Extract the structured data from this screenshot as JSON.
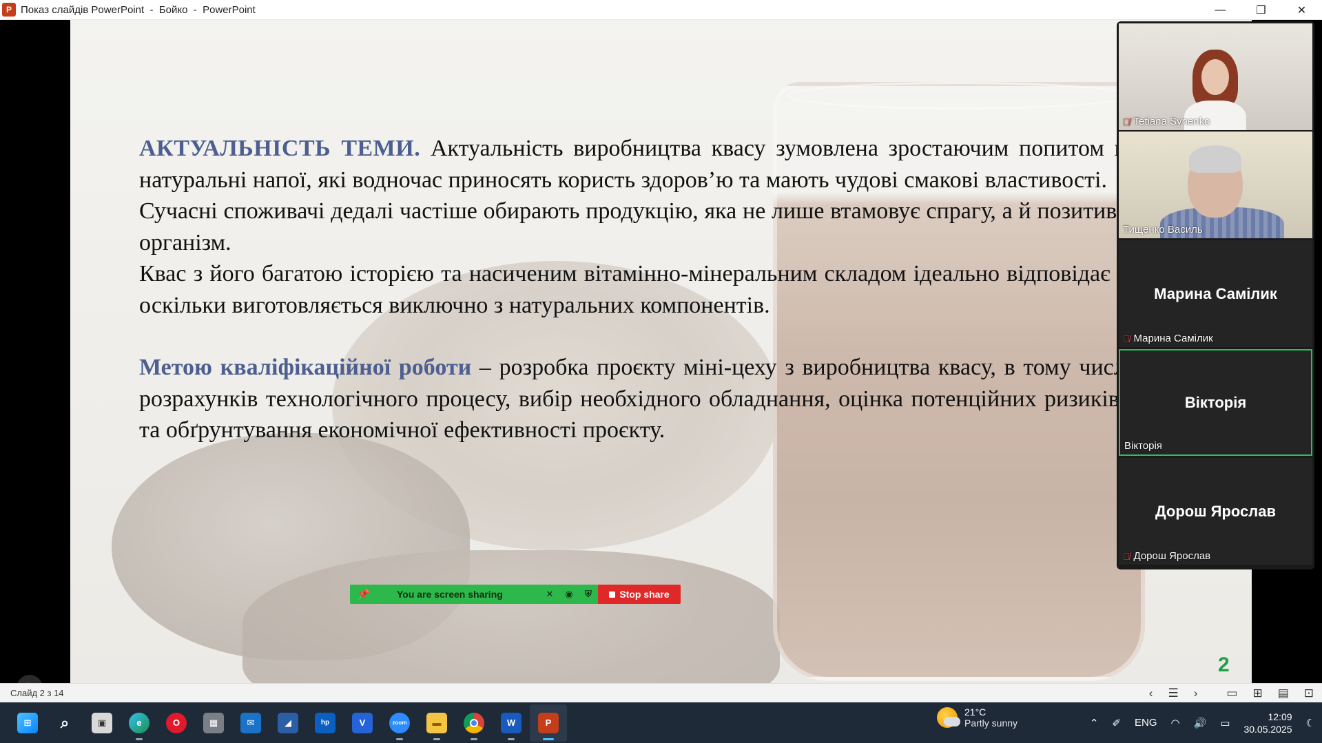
{
  "window": {
    "title": "Показ слайдів PowerPoint  -  Бойко  -  PowerPoint",
    "app_icon_letter": "P",
    "minimize": "—",
    "restore": "❐",
    "close": "✕"
  },
  "slide": {
    "heading1": "АКТУАЛЬНІСТЬ ТЕМИ.",
    "para1": " Актуальність виробництва квасу зумовлена зростаючим попитом на традиційні натуральні напої, які водночас приносять користь здоров’ю та мають чудові смакові властивості.",
    "para2": "Сучасні споживачі дедалі частіше обирають продукцію, яка не лише втамовує спрагу, а й позитивно впливає на організм.",
    "para3": "Квас з його багатою історією та насиченим вітамінно-мінеральним складом ідеально відповідає цим вимогам, оскільки виготовляється виключно з натуральних компонентів.",
    "heading2": "Метою кваліфікаційної роботи",
    "para4": " – розробка проєкту міні-цеху з виробництва квасу, в тому числі проведення розрахунків технологічного процесу, вибір необхідного обладнання, оцінка потенційних ризиків виробництва та обґрунтування економічної ефективності проєкту.",
    "number": "2"
  },
  "share_bar": {
    "label": "You are screen sharing",
    "stop_label": "Stop share"
  },
  "participants": [
    {
      "name": "Tetiana Synenko",
      "muted": true,
      "video": true
    },
    {
      "name": "Тищенко Василь",
      "muted": false,
      "video": true
    },
    {
      "name": "Марина Самілик",
      "muted": true,
      "video": false
    },
    {
      "name": "Вікторія",
      "muted": false,
      "video": false,
      "active": true
    },
    {
      "name": "Дорош Ярослав",
      "muted": true,
      "video": false
    }
  ],
  "statusbar": {
    "slide_of": "Слайд 2 з 14"
  },
  "weather": {
    "temp": "21°C",
    "condition": "Partly sunny"
  },
  "tray": {
    "language": "ENG",
    "time": "12:09",
    "date": "30.05.2025"
  },
  "colors": {
    "accent": "#4c5f90",
    "slide_number": "#1e9f4a",
    "share_green": "#2db84b",
    "stop_red": "#e02828",
    "active_tile": "#26c25a"
  }
}
